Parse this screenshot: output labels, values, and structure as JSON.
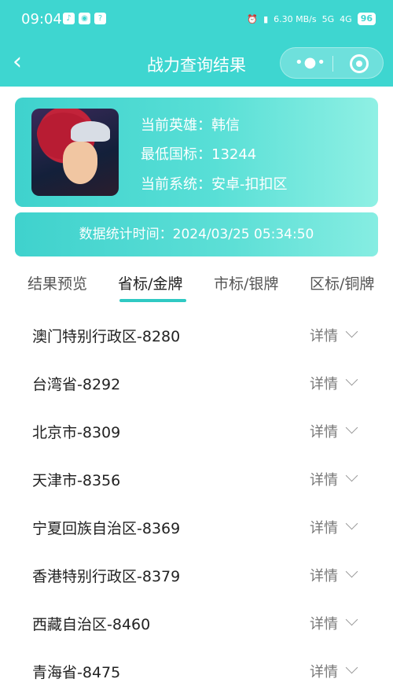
{
  "statusbar": {
    "time": "09:04",
    "network_speed": "6.30",
    "network_unit": "MB/s",
    "signal1": "5G",
    "signal2": "4G",
    "battery": "96"
  },
  "navbar": {
    "title": "战力查询结果"
  },
  "hero": {
    "hero_label": "当前英雄：",
    "hero_value": "韩信",
    "min_label": "最低国标：",
    "min_value": "13244",
    "system_label": "当前系统：",
    "system_value": "安卓-扣扣区"
  },
  "stats": {
    "time_text": "数据统计时间：2024/03/25 05:34:50"
  },
  "tabs": [
    {
      "label": "结果预览"
    },
    {
      "label": "省标/金牌"
    },
    {
      "label": "市标/银牌"
    },
    {
      "label": "区标/铜牌"
    }
  ],
  "active_tab": "省标/金牌",
  "list": {
    "detail_label": "详情",
    "items": [
      {
        "name": "澳门特别行政区-8280"
      },
      {
        "name": "台湾省-8292"
      },
      {
        "name": "北京市-8309"
      },
      {
        "name": "天津市-8356"
      },
      {
        "name": "宁夏回族自治区-8369"
      },
      {
        "name": "香港特别行政区-8379"
      },
      {
        "name": "西藏自治区-8460"
      },
      {
        "name": "青海省-8475"
      }
    ]
  },
  "colors": {
    "accent": "#3ed6d0",
    "underline": "#2fc9c3"
  }
}
